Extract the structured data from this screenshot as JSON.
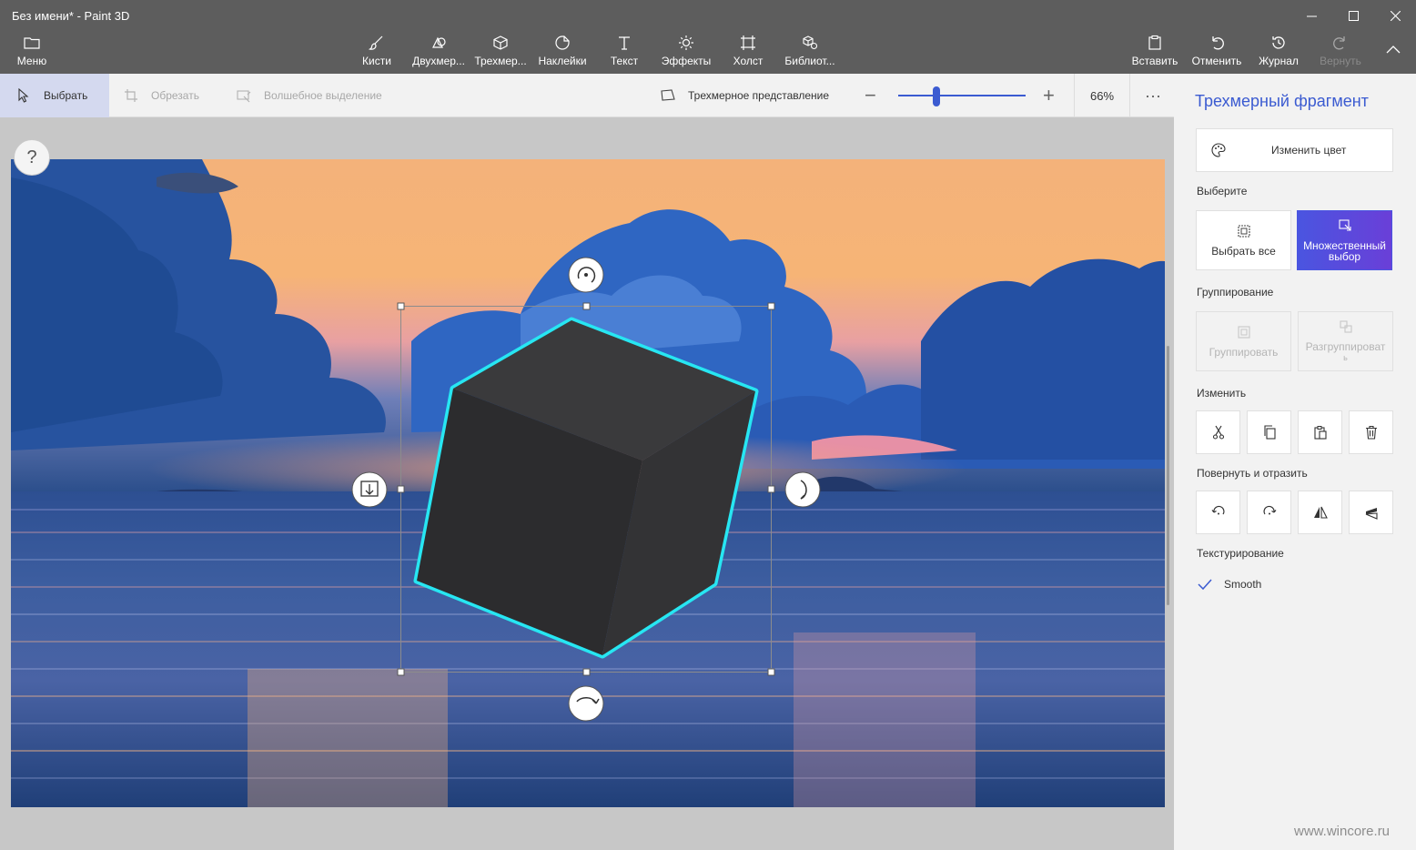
{
  "window": {
    "title": "Без имени* - Paint 3D"
  },
  "ribbon": {
    "menu": "Меню",
    "items": [
      "Кисти",
      "Двухмер...",
      "Трехмер...",
      "Наклейки",
      "Текст",
      "Эффекты",
      "Холст",
      "Библиот..."
    ],
    "right": {
      "paste": "Вставить",
      "undo": "Отменить",
      "history": "Журнал",
      "redo": "Вернуть"
    }
  },
  "toolbar": {
    "select": "Выбрать",
    "crop": "Обрезать",
    "magic": "Волшебное выделение",
    "view3d": "Трехмерное представление",
    "zoom_value": "66%",
    "zoom_level": 0.3,
    "more": "···"
  },
  "canvas": {
    "help": "?"
  },
  "panel": {
    "title": "Трехмерный фрагмент",
    "change_color": "Изменить цвет",
    "select_section": "Выберите",
    "select_all": "Выбрать все",
    "multi_select_1": "Множественный",
    "multi_select_2": "выбор",
    "group_section": "Группирование",
    "group": "Группировать",
    "ungroup_1": "Разгруппироват",
    "ungroup_2": "ь",
    "edit_section": "Изменить",
    "rotate_section": "Повернуть и отразить",
    "texture_section": "Текстурирование",
    "smooth": "Smooth",
    "smooth_checked": true
  },
  "watermark": "www.wincore.ru",
  "colors": {
    "accent": "#3b5bd1",
    "selection_outline": "#27e6f2",
    "ribbon_bg": "#5d5d5d"
  }
}
